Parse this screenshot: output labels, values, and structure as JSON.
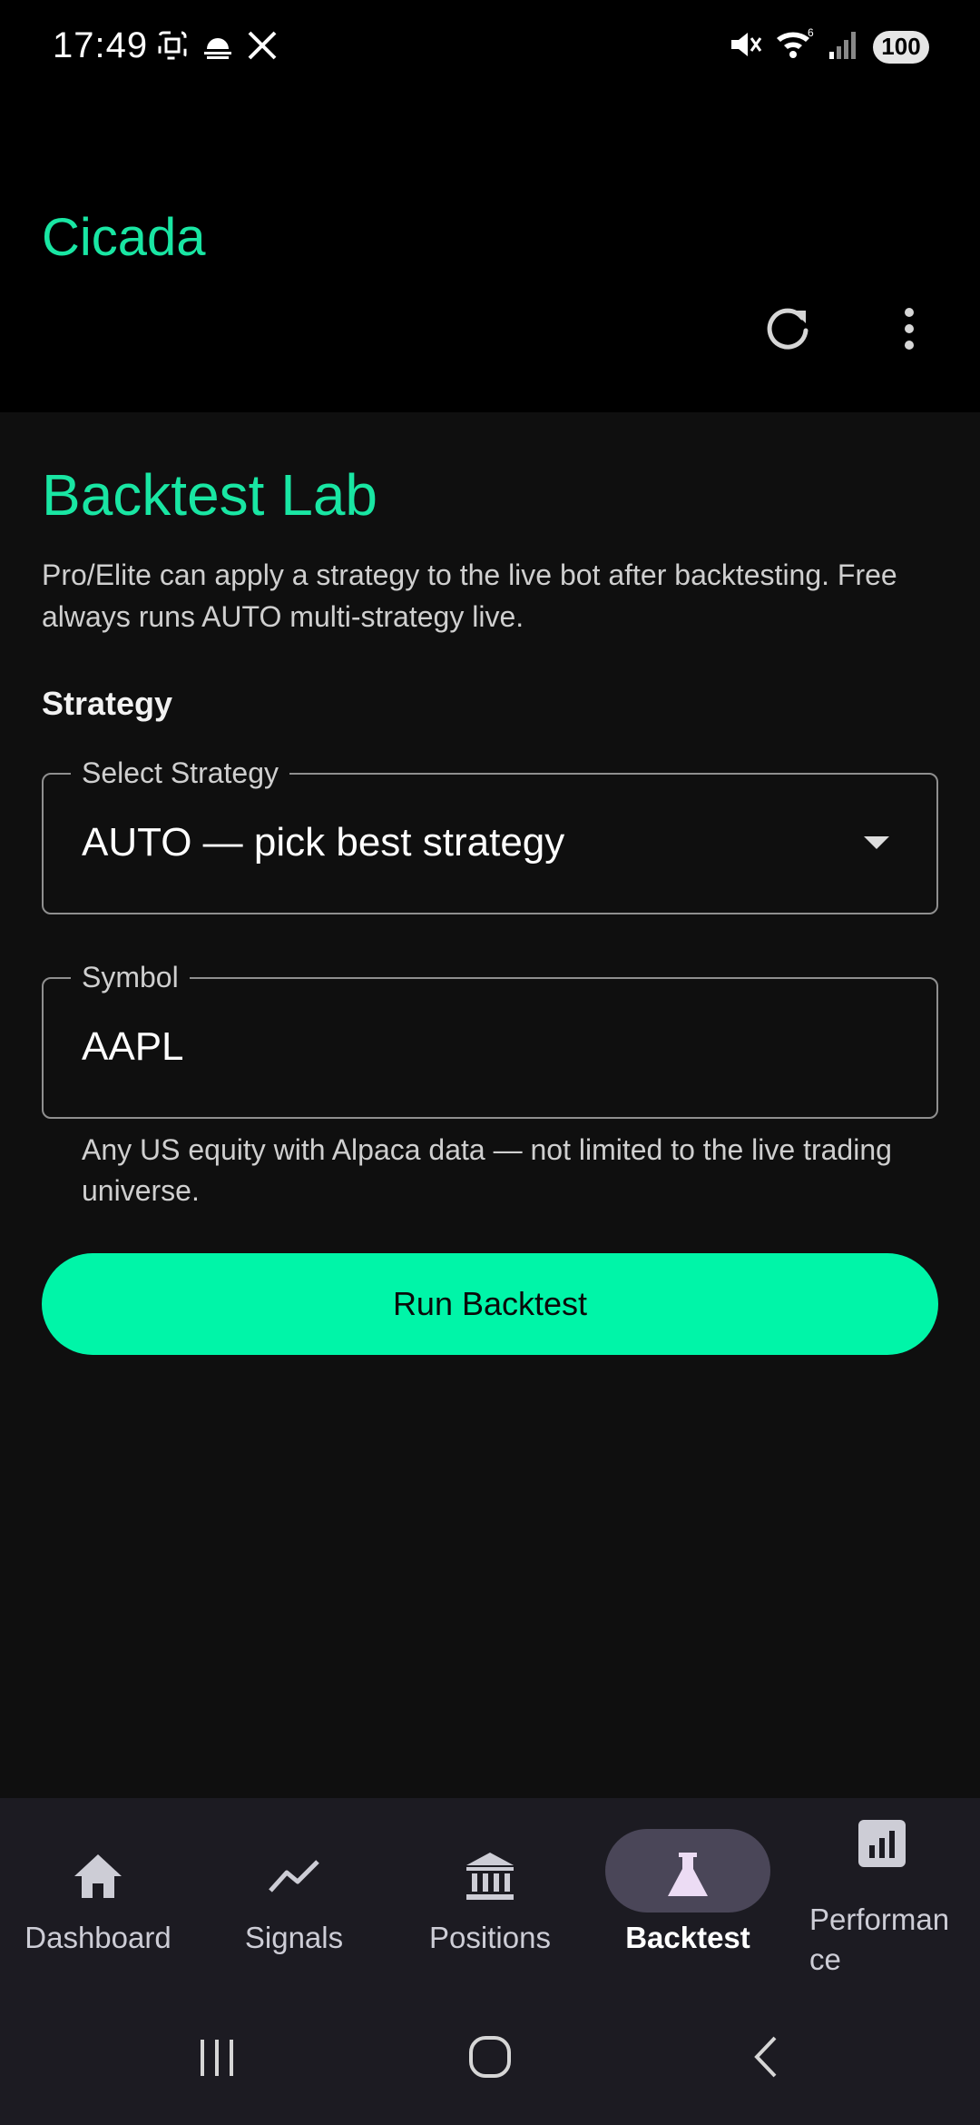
{
  "status_bar": {
    "time": "17:49",
    "battery": "100",
    "signal_superscript": "6"
  },
  "app_bar": {
    "title": "Cicada"
  },
  "backtest": {
    "title": "Backtest Lab",
    "description": "Pro/Elite can apply a strategy to the live bot after backtesting. Free always runs AUTO multi-strategy live.",
    "section_label": "Strategy",
    "strategy_field": {
      "legend": "Select Strategy",
      "value": "AUTO — pick best strategy"
    },
    "symbol_field": {
      "legend": "Symbol",
      "value": "AAPL"
    },
    "helper_text": "Any US equity with Alpaca data — not limited to the live trading universe.",
    "run_button": "Run Backtest"
  },
  "bottom_nav": {
    "items": [
      {
        "label": "Dashboard",
        "icon": "home-icon"
      },
      {
        "label": "Signals",
        "icon": "trend-icon"
      },
      {
        "label": "Positions",
        "icon": "bank-icon"
      },
      {
        "label": "Backtest",
        "icon": "flask-icon",
        "active": true
      },
      {
        "label": "Performance",
        "icon": "bar-chart-icon"
      }
    ]
  },
  "colors": {
    "accent": "#19e6a3",
    "button": "#00f5a8",
    "content_bg": "#0f0f0f",
    "nav_bg": "#1c1b22",
    "nav_active_pill": "#4a4658"
  }
}
